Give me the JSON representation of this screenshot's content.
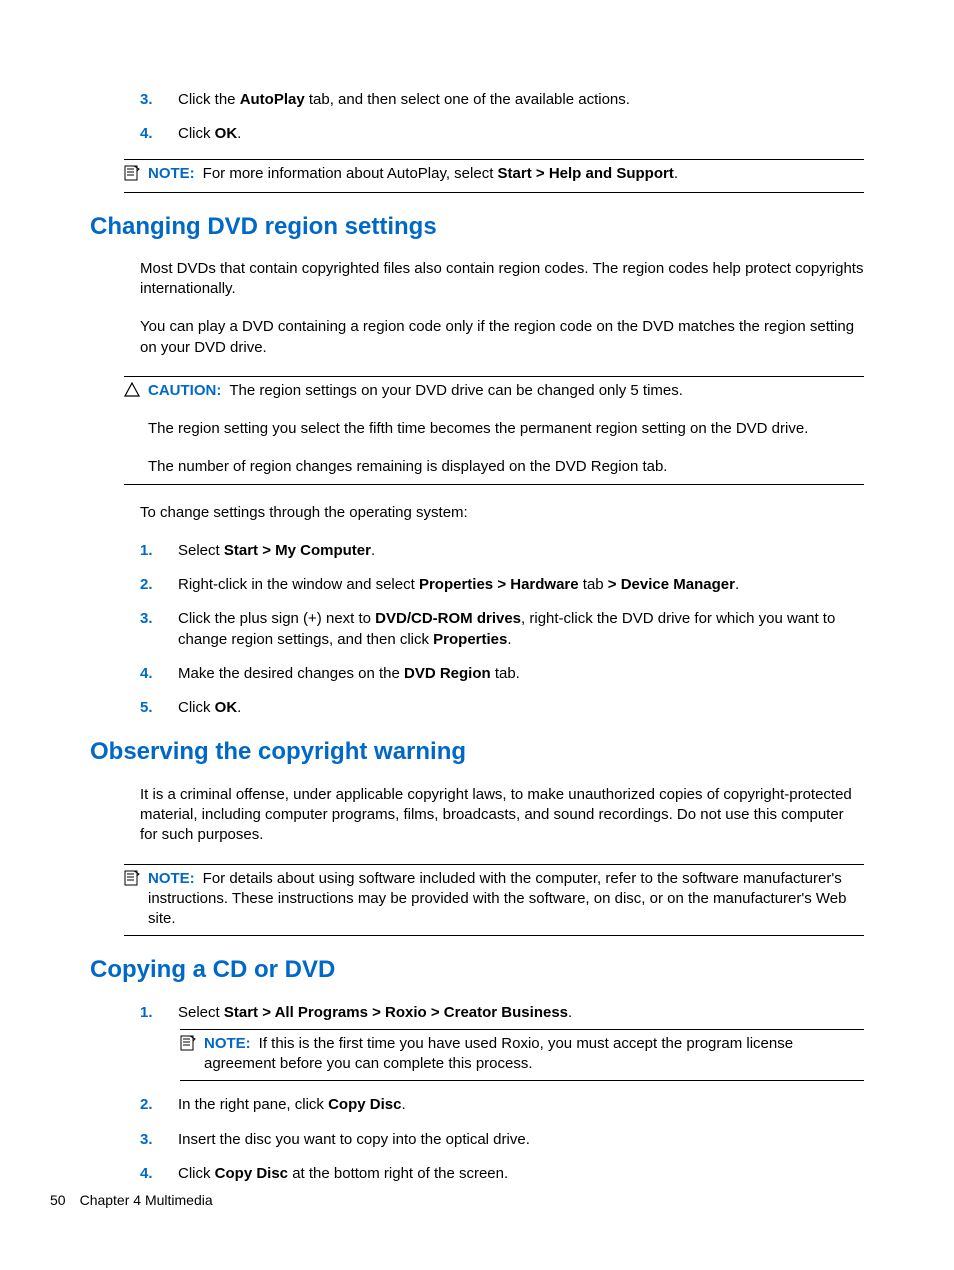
{
  "topList": {
    "item3": {
      "num": "3.",
      "pre": "Click the ",
      "bold1": "AutoPlay",
      "post": " tab, and then select one of the available actions."
    },
    "item4": {
      "num": "4.",
      "pre": "Click ",
      "bold1": "OK",
      "post": "."
    }
  },
  "note1": {
    "label": "NOTE:",
    "pre": "For more information about AutoPlay, select ",
    "bold": "Start > Help and Support",
    "post": "."
  },
  "sectionA": {
    "title": "Changing DVD region settings",
    "p1": "Most DVDs that contain copyrighted files also contain region codes. The region codes help protect copyrights internationally.",
    "p2": "You can play a DVD containing a region code only if the region code on the DVD matches the region setting on your DVD drive.",
    "caution": {
      "label": "CAUTION:",
      "l1": "The region settings on your DVD drive can be changed only 5 times.",
      "l2": "The region setting you select the fifth time becomes the permanent region setting on the DVD drive.",
      "l3": "The number of region changes remaining is displayed on the DVD Region tab."
    },
    "p3": "To change settings through the operating system:",
    "steps": {
      "s1": {
        "num": "1.",
        "pre": "Select ",
        "bold": "Start > My Computer",
        "post": "."
      },
      "s2": {
        "num": "2.",
        "pre": "Right-click in the window and select ",
        "bold1": "Properties > Hardware",
        "mid": " tab ",
        "bold2": "> Device Manager",
        "post": "."
      },
      "s3": {
        "num": "3.",
        "pre": "Click the plus sign (+) next to ",
        "bold1": "DVD/CD-ROM drives",
        "mid": ", right-click the DVD drive for which you want to change region settings, and then click ",
        "bold2": "Properties",
        "post": "."
      },
      "s4": {
        "num": "4.",
        "pre": "Make the desired changes on the ",
        "bold": "DVD Region",
        "post": " tab."
      },
      "s5": {
        "num": "5.",
        "pre": "Click ",
        "bold": "OK",
        "post": "."
      }
    }
  },
  "sectionB": {
    "title": "Observing the copyright warning",
    "p1": "It is a criminal offense, under applicable copyright laws, to make unauthorized copies of copyright-protected material, including computer programs, films, broadcasts, and sound recordings. Do not use this computer for such purposes.",
    "note": {
      "label": "NOTE:",
      "text": "For details about using software included with the computer, refer to the software manufacturer's instructions. These instructions may be provided with the software, on disc, or on the manufacturer's Web site."
    }
  },
  "sectionC": {
    "title": "Copying a CD or DVD",
    "steps": {
      "s1": {
        "num": "1.",
        "pre": "Select ",
        "bold": "Start > All Programs > Roxio > Creator Business",
        "post": "."
      },
      "note": {
        "label": "NOTE:",
        "text": "If this is the first time you have used Roxio, you must accept the program license agreement before you can complete this process."
      },
      "s2": {
        "num": "2.",
        "pre": "In the right pane, click ",
        "bold": "Copy Disc",
        "post": "."
      },
      "s3": {
        "num": "3.",
        "text": "Insert the disc you want to copy into the optical drive."
      },
      "s4": {
        "num": "4.",
        "pre": "Click ",
        "bold": "Copy Disc",
        "post": " at the bottom right of the screen."
      }
    }
  },
  "footer": {
    "page": "50",
    "chapter": "Chapter 4   Multimedia"
  }
}
